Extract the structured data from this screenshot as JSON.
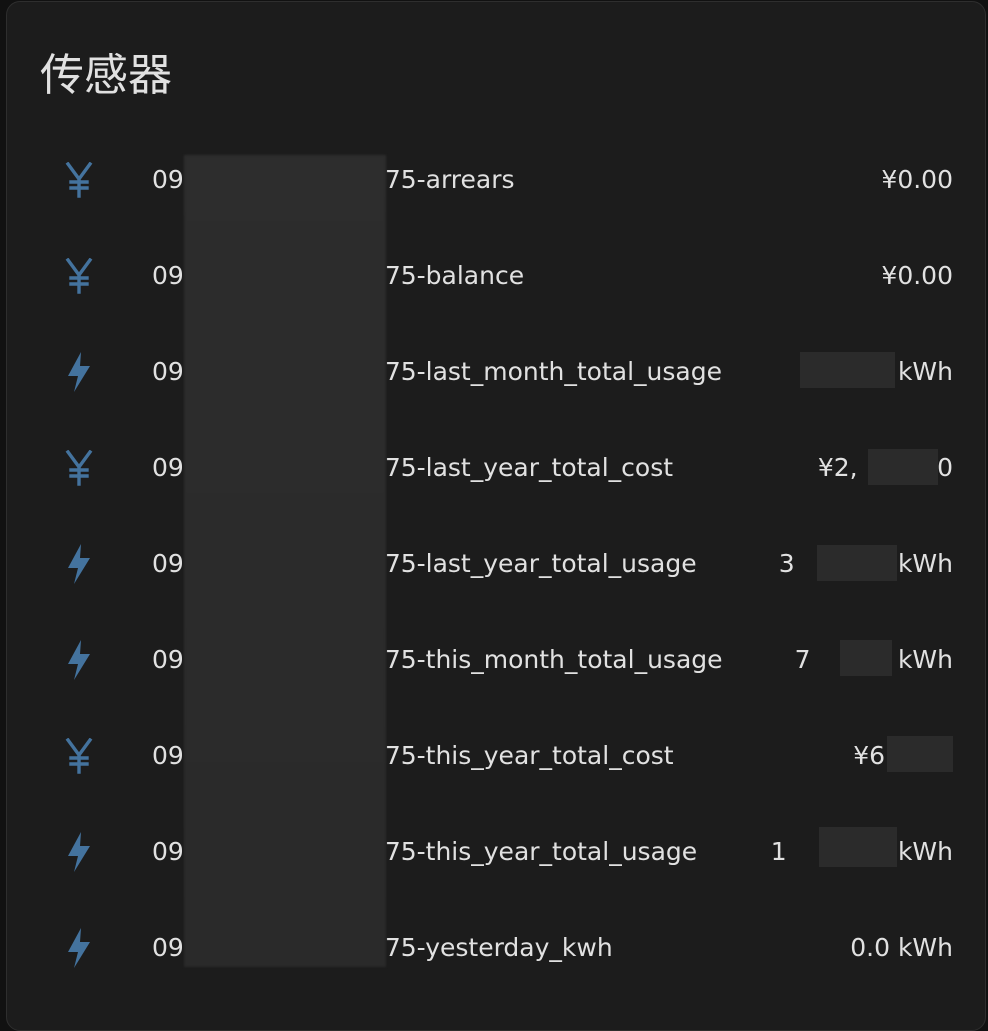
{
  "card": {
    "title": "传感器"
  },
  "sensors": [
    {
      "icon": "yen-icon",
      "name": "09",
      "suffix": "75-arrears",
      "state": "¥0.00"
    },
    {
      "icon": "yen-icon",
      "name": "09",
      "suffix": "75-balance",
      "state": "¥0.00"
    },
    {
      "icon": "lightning-icon",
      "name": "09",
      "suffix": "75-last_month_total_usage",
      "state": "kWh"
    },
    {
      "icon": "yen-icon",
      "name": "09",
      "suffix": "75-last_year_total_cost",
      "state": "¥2,          0"
    },
    {
      "icon": "lightning-icon",
      "name": "09",
      "suffix": "75-last_year_total_usage",
      "state": "3             kWh"
    },
    {
      "icon": "lightning-icon",
      "name": "09",
      "suffix": "75-this_month_total_usage",
      "state": "7           kWh"
    },
    {
      "icon": "yen-icon",
      "name": "09",
      "suffix": "75-this_year_total_cost",
      "state": "¥6"
    },
    {
      "icon": "lightning-icon",
      "name": "09",
      "suffix": "75-this_year_total_usage",
      "state": "1              kWh"
    },
    {
      "icon": "lightning-icon",
      "name": "09",
      "suffix": "75-yesterday_kwh",
      "state": "0.0 kWh"
    }
  ],
  "colors": {
    "icon": "#44739e",
    "background": "#1c1c1c",
    "text": "#e1e1e1"
  }
}
